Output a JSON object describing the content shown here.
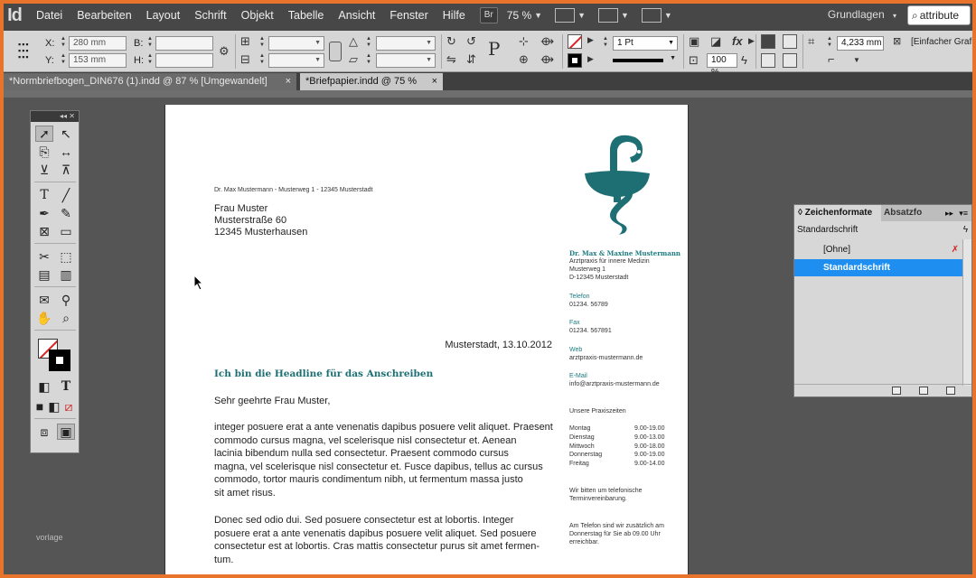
{
  "app": {
    "logo": "Id",
    "logo_icon": "indesign-logo-icon"
  },
  "menu": {
    "items": [
      "Datei",
      "Bearbeiten",
      "Layout",
      "Schrift",
      "Objekt",
      "Tabelle",
      "Ansicht",
      "Fenster",
      "Hilfe"
    ],
    "bridge_button": "Br",
    "zoom": "75 %",
    "workspace": "Grundlagen",
    "search_text": "attribute"
  },
  "control": {
    "x_label": "X:",
    "x_value": "280 mm",
    "y_label": "Y:",
    "y_value": "153 mm",
    "b_label": "B:",
    "h_label": "H:",
    "stroke_weight": "1 Pt",
    "scale_percent": "100 %",
    "dimension": "4,233 mm",
    "style_select": "[Einfacher Grafi"
  },
  "tabs": [
    {
      "label": "*Normbriefbogen_DIN676 (1).indd @ 87 % [Umgewandelt]",
      "close": "×",
      "active": false
    },
    {
      "label": "*Briefpapier.indd @ 75 %",
      "close": "×",
      "active": true
    }
  ],
  "letter": {
    "sender_line": "Dr. Max  Mustermann - Musterweg 1 - 12345 Musterstadt",
    "recipient": [
      "Frau Muster",
      "Musterstraße 60",
      "12345 Musterhausen"
    ],
    "date": "Musterstadt, 13.10.2012",
    "headline": "Ich bin die Headline für das Anschreiben",
    "salutation": "Sehr geehrte Frau Muster,",
    "paragraph1_lines": [
      "integer posuere erat a ante venenatis dapibus posuere velit aliquet. Praesent",
      "commodo cursus magna, vel scelerisque nisl consectetur et. Aenean",
      "lacinia bibendum nulla sed consectetur. Praesent commodo cursus",
      "magna, vel scelerisque nisl consectetur et. Fusce dapibus, tellus ac cursus",
      "commodo, tortor mauris condimentum nibh, ut fermentum massa justo",
      "sit amet risus."
    ],
    "paragraph2_lines": [
      "Donec sed odio dui. Sed posuere consectetur est at lobortis. Integer",
      "posuere erat a ante venenatis dapibus posuere velit aliquet. Sed posuere",
      "consectetur est at lobortis. Cras mattis consectetur purus sit amet fermen-",
      "tum."
    ],
    "logo_icon": "bowl-of-hygieia-icon",
    "sidebar": {
      "practice_name": "Dr. Max & Maxine Mustermann",
      "practice_lines": [
        "Arztpraxis für innere Medizin",
        "Musterweg 1",
        "D-12345 Musterstadt"
      ],
      "phone_label": "Telefon",
      "phone": "01234. 56789",
      "fax_label": "Fax",
      "fax": "01234. 567891",
      "web_label": "Web",
      "web": "arztpraxis-mustermann.de",
      "email_label": "E-Mail",
      "email": "info@arztpraxis-mustermann.de",
      "hours_label": "Unsere Praxiszeiten",
      "hours": [
        {
          "day": "Montag",
          "time": "9.00-19.00"
        },
        {
          "day": "Dienstag",
          "time": "9.00-13.00"
        },
        {
          "day": "Mittwoch",
          "time": "9.00-18.00"
        },
        {
          "day": "Donnerstag",
          "time": "9.00-19.00"
        },
        {
          "day": "Freitag",
          "time": "9.00-14.00"
        }
      ],
      "note1": [
        "Wir bitten um telefonische",
        "Terminvereinbarung."
      ],
      "note2": [
        "Am Telefon sind wir zusätzlich am",
        "Donnerstag für Sie ab 09.00 Uhr",
        "erreichbar."
      ]
    }
  },
  "char_panel": {
    "tab_active": "Zeichenformate",
    "tab_inactive": "Absatzfo",
    "tab_menu": "▸▸",
    "current_style": "Standardschrift",
    "styles": [
      {
        "label": "[Ohne]",
        "selected": false
      },
      {
        "label": "Standardschrift",
        "selected": true
      }
    ]
  },
  "tools_panel": {
    "collapse": "◂◂ ✕"
  },
  "watermark": "vorlage",
  "colors": {
    "frame": "#e8732a",
    "accent": "#1d7b80",
    "selection": "#1e8ff0"
  }
}
